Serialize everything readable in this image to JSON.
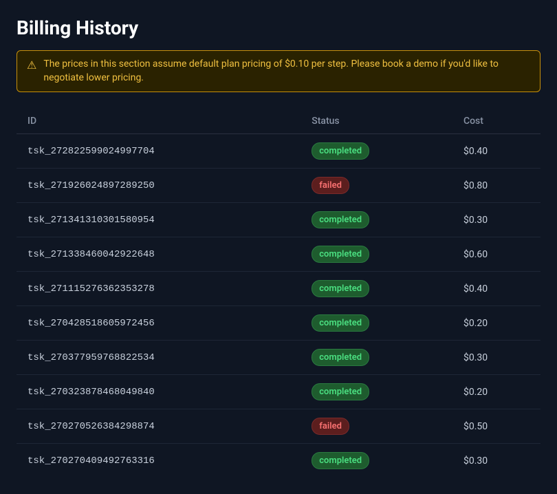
{
  "page": {
    "title": "Billing History"
  },
  "notice": {
    "icon": "⚠",
    "text": "The prices in this section assume default plan pricing of $0.10 per step. Please book a demo if you'd like to negotiate lower pricing."
  },
  "table": {
    "columns": [
      {
        "key": "id",
        "label": "ID"
      },
      {
        "key": "status",
        "label": "Status"
      },
      {
        "key": "cost",
        "label": "Cost"
      }
    ],
    "rows": [
      {
        "id": "tsk_272822599024997704",
        "status": "completed",
        "cost": "$0.40"
      },
      {
        "id": "tsk_271926024897289250",
        "status": "failed",
        "cost": "$0.80"
      },
      {
        "id": "tsk_271341310301580954",
        "status": "completed",
        "cost": "$0.30"
      },
      {
        "id": "tsk_271338460042922648",
        "status": "completed",
        "cost": "$0.60"
      },
      {
        "id": "tsk_271115276362353278",
        "status": "completed",
        "cost": "$0.40"
      },
      {
        "id": "tsk_270428518605972456",
        "status": "completed",
        "cost": "$0.20"
      },
      {
        "id": "tsk_270377959768822534",
        "status": "completed",
        "cost": "$0.30"
      },
      {
        "id": "tsk_270323878468049840",
        "status": "completed",
        "cost": "$0.20"
      },
      {
        "id": "tsk_270270526384298874",
        "status": "failed",
        "cost": "$0.50"
      },
      {
        "id": "tsk_270270409492763316",
        "status": "completed",
        "cost": "$0.30"
      }
    ]
  }
}
